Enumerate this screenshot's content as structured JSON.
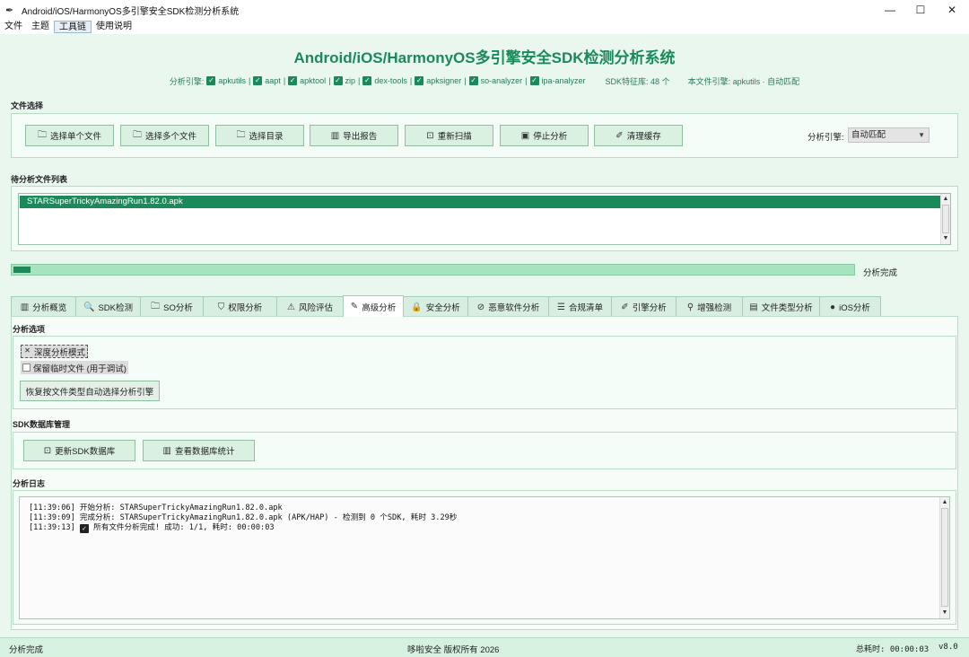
{
  "window": {
    "title": "Android/iOS/HarmonyOS多引擎安全SDK检测分析系统",
    "minimize_glyph": "—",
    "maximize_glyph": "☐",
    "close_glyph": "✕"
  },
  "menu": [
    "文件",
    "主题",
    "工具链",
    "使用说明"
  ],
  "header": {
    "title": "Android/iOS/HarmonyOS多引擎安全SDK检测分析系统",
    "engine_prefix": "分析引擎:",
    "engines": [
      "apkutils",
      "aapt",
      "apktool",
      "zip",
      "dex-tools",
      "apksigner",
      "so-analyzer",
      "ipa-analyzer"
    ],
    "sdk_db": "SDK特征库: 48 个",
    "file_engine": "本文件引擎: apkutils · 自动匹配"
  },
  "file_select": {
    "label": "文件选择",
    "buttons": [
      {
        "icon": "folder-icon",
        "glyph": "🗀",
        "label": "选择单个文件"
      },
      {
        "icon": "folder-icon",
        "glyph": "🗀",
        "label": "选择多个文件"
      },
      {
        "icon": "folder-icon",
        "glyph": "🗀",
        "label": "选择目录"
      },
      {
        "icon": "chart-icon",
        "glyph": "▥",
        "label": "导出报告"
      },
      {
        "icon": "refresh-icon",
        "glyph": "⊡",
        "label": "重新扫描"
      },
      {
        "icon": "stop-icon",
        "glyph": "▣",
        "label": "停止分析"
      },
      {
        "icon": "brush-icon",
        "glyph": "✐",
        "label": "清理缓存"
      }
    ],
    "engine_label": "分析引擎:",
    "engine_value": "自动匹配"
  },
  "file_list": {
    "label": "待分析文件列表",
    "items": [
      "STARSuperTrickyAmazingRun1.82.0.apk"
    ]
  },
  "progress": {
    "value": 0.02,
    "status": "分析完成"
  },
  "tabs": [
    {
      "label": "分析概览",
      "glyph": "▥",
      "icon": "chart-icon"
    },
    {
      "label": "SDK检测",
      "glyph": "🔍",
      "icon": "search-icon"
    },
    {
      "label": "SO分析",
      "glyph": "🗀",
      "icon": "folder-icon"
    },
    {
      "label": "权限分析",
      "glyph": "⛉",
      "icon": "shield-icon"
    },
    {
      "label": "风险评估",
      "glyph": "⚠",
      "icon": "warning-icon"
    },
    {
      "label": "高级分析",
      "glyph": "✎",
      "icon": "pencil-icon"
    },
    {
      "label": "安全分析",
      "glyph": "🔒",
      "icon": "lock-icon"
    },
    {
      "label": "恶意软件分析",
      "glyph": "⊘",
      "icon": "malware-icon"
    },
    {
      "label": "合规清单",
      "glyph": "☰",
      "icon": "list-icon"
    },
    {
      "label": "引擎分析",
      "glyph": "✐",
      "icon": "engine-icon"
    },
    {
      "label": "增强检测",
      "glyph": "⚲",
      "icon": "rocket-icon"
    },
    {
      "label": "文件类型分析",
      "glyph": "▤",
      "icon": "document-icon"
    },
    {
      "label": "iOS分析",
      "glyph": "●",
      "icon": "apple-icon"
    }
  ],
  "analysis_options": {
    "label": "分析选项",
    "deep_mode": {
      "label": "深度分析模式",
      "checked": true
    },
    "keep_temp": {
      "label": "保留临时文件 (用于调试)",
      "checked": false
    },
    "restore_button": "恢复按文件类型自动选择分析引擎"
  },
  "sdk_db": {
    "label": "SDK数据库管理",
    "update_button": "更新SDK数据库",
    "stats_button": "查看数据库统计"
  },
  "log": {
    "label": "分析日志",
    "lines": [
      "[11:39:06] 开始分析: STARSuperTrickyAmazingRun1.82.0.apk",
      "[11:39:09] 完成分析: STARSuperTrickyAmazingRun1.82.0.apk (APK/HAP) - 检测到 0 个SDK, 耗时 3.29秒"
    ],
    "line3_prefix": "[11:39:13]",
    "line3_text": "所有文件分析完成! 成功: 1/1, 耗时: 00:00:03"
  },
  "status": {
    "left": "分析完成",
    "center": "哆啦安全 版权所有 2026",
    "right": "总耗时: 00:00:03",
    "version": "v8.0"
  }
}
